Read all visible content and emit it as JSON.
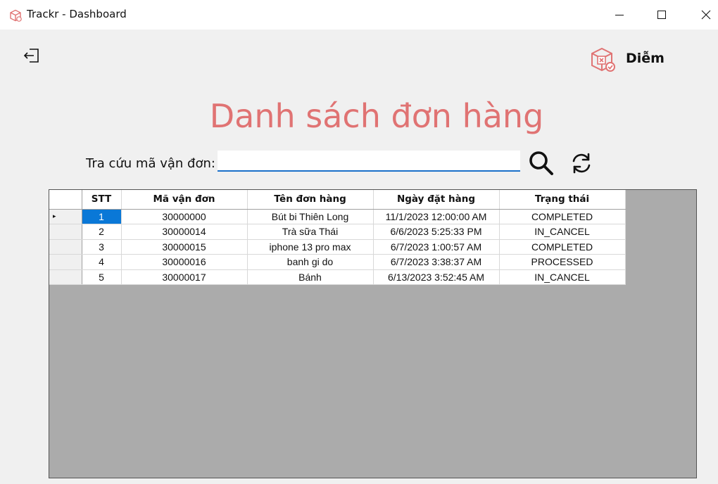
{
  "window": {
    "title": "Trackr - Dashboard"
  },
  "header": {
    "user_name": "Diễm"
  },
  "main": {
    "heading": "Danh sách đơn hàng",
    "search_label": "Tra cứu mã vận đơn:",
    "search_value": "",
    "search_placeholder": ""
  },
  "grid": {
    "columns": [
      "STT",
      "Mã vận đơn",
      "Tên đơn hàng",
      "Ngày đặt hàng",
      "Trạng thái"
    ],
    "rows": [
      [
        "1",
        "30000000",
        "Bút bi Thiên Long",
        "11/1/2023 12:00:00 AM",
        "COMPLETED"
      ],
      [
        "2",
        "30000014",
        "Trà sữa Thái",
        "6/6/2023 5:25:33 PM",
        "IN_CANCEL"
      ],
      [
        "3",
        "30000015",
        "iphone 13 pro max",
        "6/7/2023 1:00:57 AM",
        "COMPLETED"
      ],
      [
        "4",
        "30000016",
        "banh gi do",
        "6/7/2023 3:38:37 AM",
        "PROCESSED"
      ],
      [
        "5",
        "30000017",
        "Bánh",
        "6/13/2023 3:52:45 AM",
        "IN_CANCEL"
      ]
    ]
  },
  "colors": {
    "heading": "#e07373",
    "accent": "#0a78d7",
    "grid_bg": "#ababab"
  },
  "icons": [
    "app-logo-icon",
    "minimize-icon",
    "maximize-icon",
    "close-icon",
    "logout-icon",
    "user-box-icon",
    "search-icon",
    "refresh-icon",
    "current-row-arrow-icon"
  ]
}
